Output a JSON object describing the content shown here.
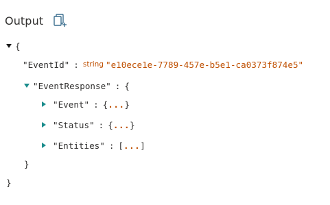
{
  "header": {
    "title": "Output",
    "copy_icon": "copy-icon"
  },
  "json_view": {
    "root_open": "{",
    "root_close": "}",
    "event_id": {
      "key": "\"EventId\"",
      "colon": ":",
      "type": "string",
      "value": "\"e10ece1e-7789-457e-b5e1-ca0373f874e5\""
    },
    "event_response": {
      "key": "\"EventResponse\"",
      "colon": ":",
      "open": "{",
      "close": "}",
      "children": [
        {
          "key": "\"Event\"",
          "colon": ":",
          "open": "{",
          "ellipsis": "...",
          "close": "}"
        },
        {
          "key": "\"Status\"",
          "colon": ":",
          "open": "{",
          "ellipsis": "...",
          "close": "}"
        },
        {
          "key": "\"Entities\"",
          "colon": ":",
          "open": "[",
          "ellipsis": "...",
          "close": "]"
        }
      ]
    }
  },
  "colors": {
    "value": "#bf4f00",
    "caret_teal": "#1a8c8c",
    "text": "#323130"
  }
}
